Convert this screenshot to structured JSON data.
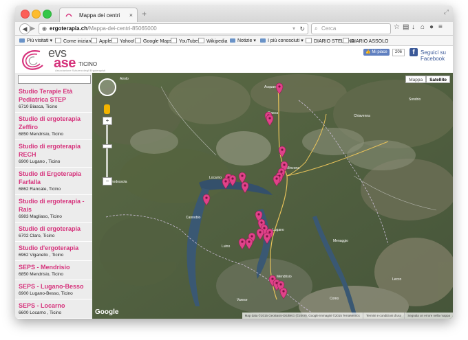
{
  "browser": {
    "tab_title": "Mappa dei centri",
    "url_host": "ergoterapia.ch",
    "url_path": "/Mappa-dei-centri-85065000",
    "search_placeholder": "Cerca",
    "bookmarks": [
      "Più visitati ▾",
      "Come iniziare",
      "Apple",
      "Yahoo!",
      "Google Maps",
      "YouTube",
      "Wikipedia",
      "Notizie ▾",
      "I più conosciuti ▾",
      "DIARIO STELLINA",
      "DIARIO ASSOLO"
    ]
  },
  "site": {
    "logo_evs": "evs",
    "logo_ase": "ase",
    "logo_region": "TICINO",
    "logo_subtitle": "Associazione Svizzera degli Ergoterapisti",
    "like_label": "Mi piace",
    "like_count": "206",
    "facebook_label": "Seguici su Facebook"
  },
  "centers": [
    {
      "name": "Studio Terapie Età Pediatrica STEP",
      "address": "6710 Biasca, Ticino"
    },
    {
      "name": "Studio di ergoterapia Zeffiro",
      "address": "6850 Mendrisio, Ticino"
    },
    {
      "name": "Studio di ergoterapia RECH",
      "address": "6900 Lugano , Ticino"
    },
    {
      "name": "Studio di Ergoterapia Farfalla",
      "address": "6862 Rancate, Ticino"
    },
    {
      "name": "Studio di ergoterapia - Rais",
      "address": "6983 Magliaso, Ticino"
    },
    {
      "name": "Studio di ergoterapia",
      "address": "6702 Claro, Ticino"
    },
    {
      "name": "Studio d'ergoterapia",
      "address": "6962 Viganello , Ticino"
    },
    {
      "name": "SEPS - Mendrisio",
      "address": "6850 Mendrisio, Ticino"
    },
    {
      "name": "SEPS - Lugano-Besso",
      "address": "6900 Lugano-Besso, Ticino"
    },
    {
      "name": "SEPS - Locarno",
      "address": "6600 Locarno , Ticino"
    }
  ],
  "map": {
    "type_map": "Mappa",
    "type_satellite": "Satellite",
    "zoom_in": "+",
    "zoom_out": "−",
    "google": "Google",
    "attribution": [
      "Map data ©2015 GeoBasis-DE/BKG (©2009), Google Immagini ©2015 TerraMetrics",
      "Termini e condizioni d'uso",
      "Segnala un errore nella mappa"
    ],
    "places": [
      "Airolo",
      "Acquarossa",
      "Biasca",
      "Bellinzona",
      "Locarno",
      "Lugano",
      "Mendrisio",
      "Varese",
      "Como",
      "Chiavenna",
      "Domodossola",
      "Lecco",
      "Cannobio",
      "Luino",
      "Menaggio",
      "Sondrio"
    ]
  }
}
